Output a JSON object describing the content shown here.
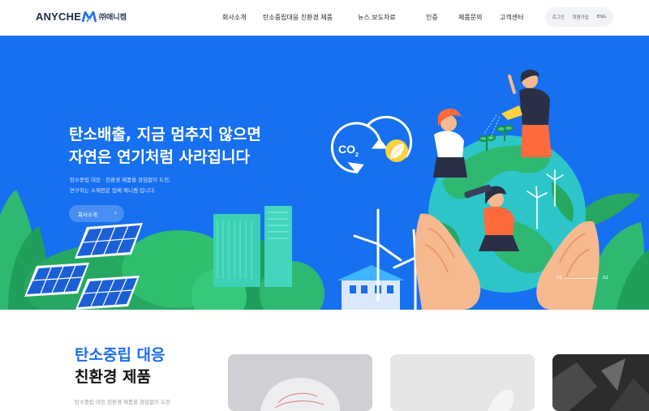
{
  "brand": {
    "logo_text": "ANYCHE",
    "logo_m": "M",
    "logo_korean": "㈜애니켐"
  },
  "nav": {
    "items": [
      {
        "label": "회사소개"
      },
      {
        "label": "탄소중립대응 친환경 제품"
      },
      {
        "label": "뉴스.보도자료"
      },
      {
        "label": "인증"
      },
      {
        "label": "제품문의"
      },
      {
        "label": "고객센터"
      }
    ],
    "utility": {
      "login": "로그인",
      "join": "회원가입",
      "lang": "ENG"
    }
  },
  "hero": {
    "title_line1": "탄소배출, 지금 멈추지 않으면",
    "title_line2": "자연은 연기처럼 사라집니다",
    "desc_line1": "탄소중립 대응 · 친환경 제품을 끊임없이 도전,",
    "desc_line2": "연구하는 소재전문 업체 애니켐 입니다.",
    "button_label": "회사소개",
    "co2_label": "CO",
    "co2_sub": "2",
    "slides": [
      "01",
      "02"
    ]
  },
  "section": {
    "title_line1": "탄소중립 대응",
    "title_line2": "친환경 제품",
    "desc": "탄소중립 대응 친환경 제품을 끊임없이 도전"
  },
  "colors": {
    "hero_bg": "#1670f0",
    "accent": "#1e6ff0",
    "plant_green": "#2eb872"
  }
}
